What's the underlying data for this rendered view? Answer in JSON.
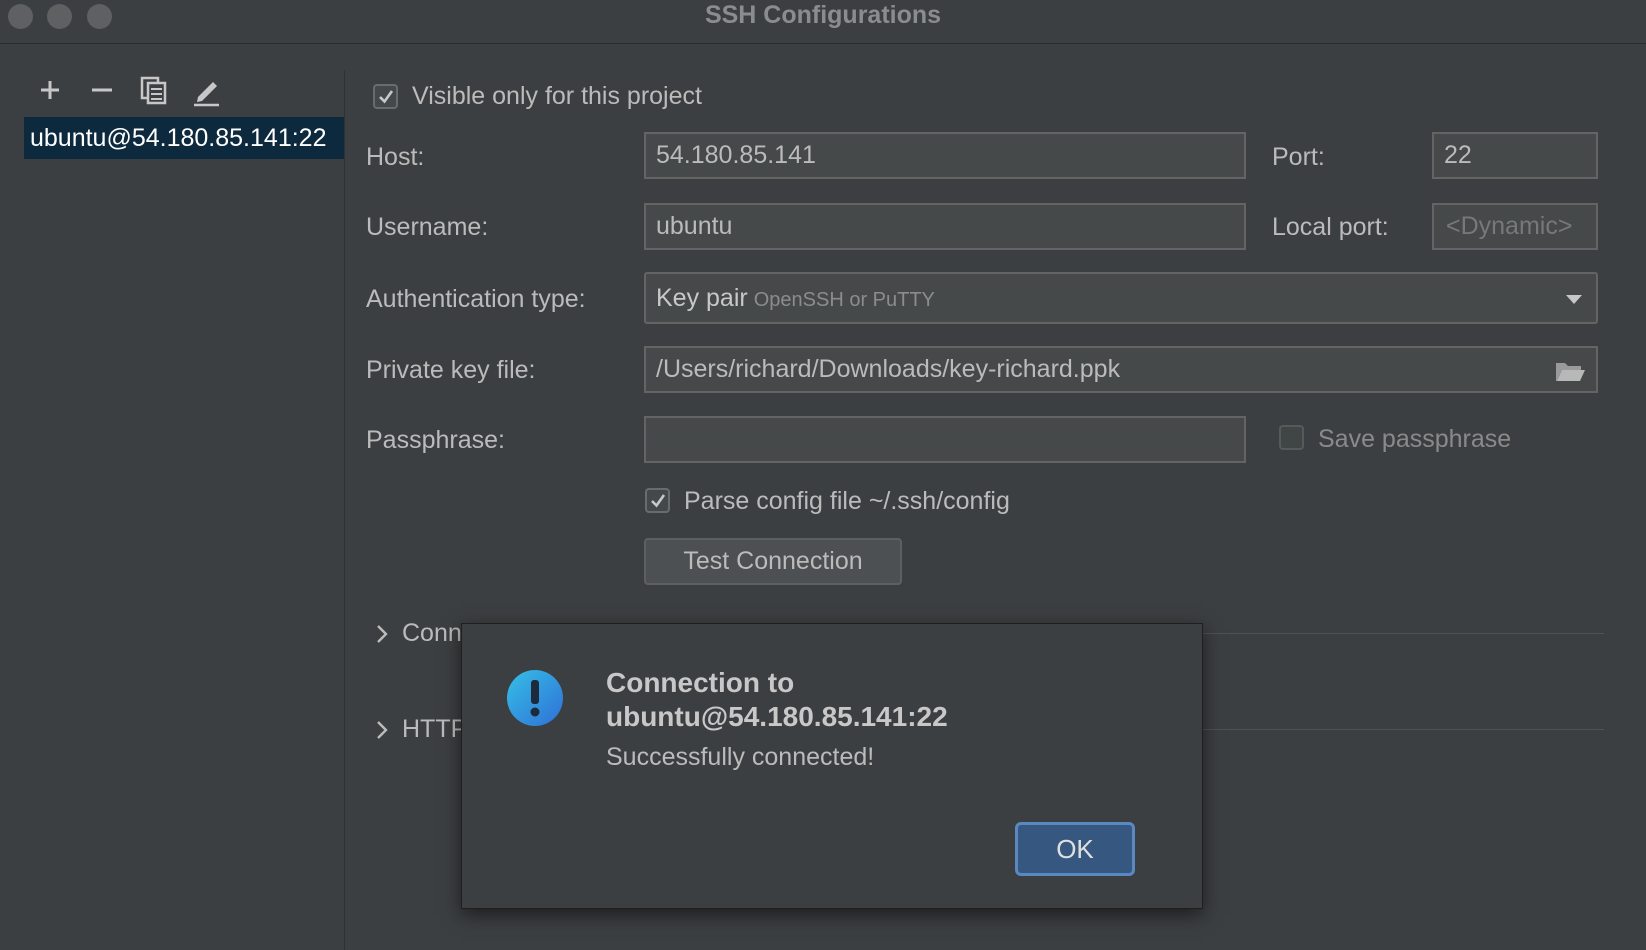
{
  "window": {
    "title": "SSH Configurations"
  },
  "sidebar": {
    "toolbar": [
      {
        "icon": "plus-icon"
      },
      {
        "icon": "minus-icon"
      },
      {
        "icon": "copy-icon"
      },
      {
        "icon": "edit-icon"
      }
    ],
    "items": [
      {
        "label": "ubuntu@54.180.85.141:22"
      }
    ]
  },
  "form": {
    "visible_only": {
      "label": "Visible only for this project",
      "checked": true
    },
    "host": {
      "label": "Host:",
      "value": "54.180.85.141"
    },
    "port": {
      "label": "Port:",
      "value": "22"
    },
    "username": {
      "label": "Username:",
      "value": "ubuntu"
    },
    "local_port": {
      "label": "Local port:",
      "placeholder": "<Dynamic>"
    },
    "auth_type": {
      "label": "Authentication type:",
      "value": "Key pair",
      "hint": "OpenSSH or PuTTY"
    },
    "private_key": {
      "label": "Private key file:",
      "value": "/Users/richard/Downloads/key-richard.ppk"
    },
    "passphrase": {
      "label": "Passphrase:",
      "value": ""
    },
    "save_passphrase": {
      "label": "Save passphrase",
      "checked": false
    },
    "parse_config": {
      "label": "Parse config file ~/.ssh/config",
      "checked": true
    },
    "test_button": "Test Connection",
    "sections": [
      {
        "label": "Connection Parameters"
      },
      {
        "label": "HTTP/SOCKS Proxy"
      }
    ]
  },
  "dialog": {
    "icon": "warning-icon",
    "title_line1": "Connection to",
    "title_line2": "ubuntu@54.180.85.141:22",
    "message": "Successfully connected!",
    "ok_label": "OK"
  },
  "colors": {
    "background": "#3c3f41",
    "selection": "#0d293e",
    "accent_button": "#365880",
    "dialog_icon": "#2f9bd6"
  }
}
